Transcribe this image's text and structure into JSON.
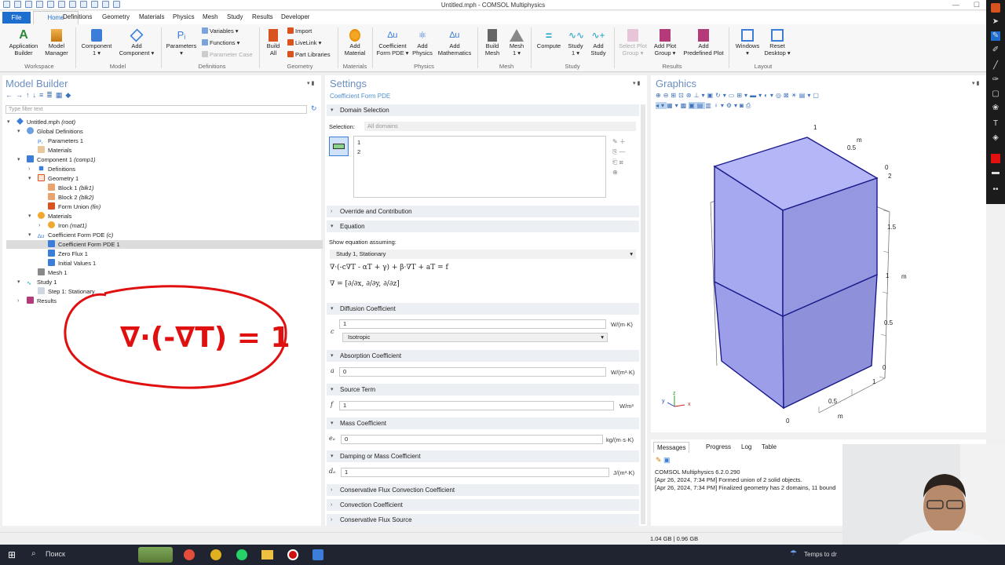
{
  "window": {
    "title": "Untitled.mph - COMSOL Multiphysics"
  },
  "menu": {
    "file": "File",
    "tabs": [
      "Home",
      "Definitions",
      "Geometry",
      "Materials",
      "Physics",
      "Mesh",
      "Study",
      "Results",
      "Developer"
    ]
  },
  "ribbon": {
    "application_builder": "Application\nBuilder",
    "model_manager": "Model\nManager",
    "workspace_label": "Workspace",
    "component": "Component\n1 ▾",
    "add_component": "Add\nComponent ▾",
    "model_label": "Model",
    "parameters": "Parameters",
    "parameters_sub": "▾",
    "variables": "Variables ▾",
    "functions": "Functions ▾",
    "parameter_case": "Parameter Case",
    "definitions_label": "Definitions",
    "build_all": "Build\nAll",
    "import": "Import",
    "livelink": "LiveLink ▾",
    "part_libraries": "Part Libraries",
    "geometry_label": "Geometry",
    "add_material": "Add\nMaterial",
    "materials_label": "Materials",
    "coefficient_form": "Coefficient\nForm PDE ▾",
    "add_physics": "Add\nPhysics",
    "add_mathematics": "Add\nMathematics",
    "physics_label": "Physics",
    "build_mesh": "Build\nMesh",
    "mesh_1": "Mesh\n1 ▾",
    "mesh_label": "Mesh",
    "compute": "Compute",
    "study_1": "Study\n1 ▾",
    "add_study": "Add\nStudy",
    "study_label": "Study",
    "select_plot_group": "Select Plot\nGroup ▾",
    "add_plot_group": "Add Plot\nGroup ▾",
    "add_predefined_plot": "Add\nPredefined Plot",
    "results_label": "Results",
    "windows": "Windows\n▾",
    "reset_desktop": "Reset\nDesktop ▾",
    "layout_label": "Layout"
  },
  "model_builder": {
    "title": "Model Builder",
    "filter_placeholder": "Type filter text",
    "tree": [
      {
        "label": "Untitled.mph",
        "tag": "(root)"
      },
      {
        "label": "Global Definitions",
        "tag": ""
      },
      {
        "label": "Parameters 1",
        "tag": ""
      },
      {
        "label": "Materials",
        "tag": ""
      },
      {
        "label": "Component 1",
        "tag": "(comp1)"
      },
      {
        "label": "Definitions",
        "tag": ""
      },
      {
        "label": "Geometry 1",
        "tag": ""
      },
      {
        "label": "Block 1",
        "tag": "(blk1)"
      },
      {
        "label": "Block 2",
        "tag": "(blk2)"
      },
      {
        "label": "Form Union",
        "tag": "(fin)"
      },
      {
        "label": "Materials",
        "tag": ""
      },
      {
        "label": "Iron",
        "tag": "(mat1)"
      },
      {
        "label": "Coefficient Form PDE",
        "tag": "(c)"
      },
      {
        "label": "Coefficient Form PDE 1",
        "tag": ""
      },
      {
        "label": "Zero Flux 1",
        "tag": ""
      },
      {
        "label": "Initial Values 1",
        "tag": ""
      },
      {
        "label": "Mesh 1",
        "tag": ""
      },
      {
        "label": "Study 1",
        "tag": ""
      },
      {
        "label": "Step 1: Stationary",
        "tag": ""
      },
      {
        "label": "Results",
        "tag": ""
      }
    ],
    "annotation": "∇·(-∇T) = 1"
  },
  "settings": {
    "title": "Settings",
    "subtitle": "Coefficient Form PDE",
    "domain_selection": "Domain Selection",
    "selection_label": "Selection:",
    "selection_value": "All domains",
    "domains": [
      "1",
      "2"
    ],
    "override": "Override and Contribution",
    "equation": "Equation",
    "show_equation": "Show equation assuming:",
    "equation_study": "Study 1, Stationary",
    "equation_text": "∇·(-c∇T - αT + γ) + β·∇T + aT = f",
    "nabla_text": "∇ = [∂/∂x, ∂/∂y, ∂/∂z]",
    "diffusion": {
      "title": "Diffusion Coefficient",
      "symbol": "c",
      "value": "1",
      "unit": "W/(m·K)",
      "type": "Isotropic"
    },
    "absorption": {
      "title": "Absorption Coefficient",
      "symbol": "a",
      "value": "0",
      "unit": "W/(m³·K)"
    },
    "source": {
      "title": "Source Term",
      "symbol": "f",
      "value": "1",
      "unit": "W/m³"
    },
    "mass": {
      "title": "Mass Coefficient",
      "symbol": "eₐ",
      "value": "0",
      "unit": "kg/(m·s·K)"
    },
    "damping": {
      "title": "Damping or Mass Coefficient",
      "symbol": "dₐ",
      "value": "1",
      "unit": "J/(m³·K)"
    },
    "conservative_flux_convection": "Conservative Flux Convection Coefficient",
    "convection": "Convection Coefficient",
    "conservative_flux_source": "Conservative Flux Source"
  },
  "graphics": {
    "title": "Graphics",
    "axis_labels": {
      "top_1": "1",
      "top_05": "0.5",
      "top_0": "0",
      "top_m": "m",
      "z_2": "2",
      "z_15": "1.5",
      "z_1": "1",
      "z_05": "0.5",
      "z_0": "0",
      "z_m": "m",
      "bottom_1": "1",
      "bottom_05": "0.5",
      "bottom_0": "0",
      "bottom_m": "m"
    },
    "axes": {
      "x": "x",
      "y": "y",
      "z": "z"
    },
    "box_color": "#a6a8f0",
    "edge_color": "#1a1a8c"
  },
  "messages": {
    "tabs": [
      "Messages",
      "Progress",
      "Log",
      "Table"
    ],
    "lines": [
      "COMSOL Multiphysics 6.2.0.290",
      "[Apr 26, 2024, 7:34 PM] Formed union of 2 solid objects.",
      "[Apr 26, 2024, 7:34 PM] Finalized geometry has 2 domains, 11 bound"
    ]
  },
  "status": {
    "memory": "1.04 GB | 0.96 GB"
  },
  "taskbar": {
    "search": "Поиск",
    "weather": "Temps to dr"
  },
  "colors": {
    "accent": "#1e6ed0",
    "annotation": "#e01010"
  }
}
